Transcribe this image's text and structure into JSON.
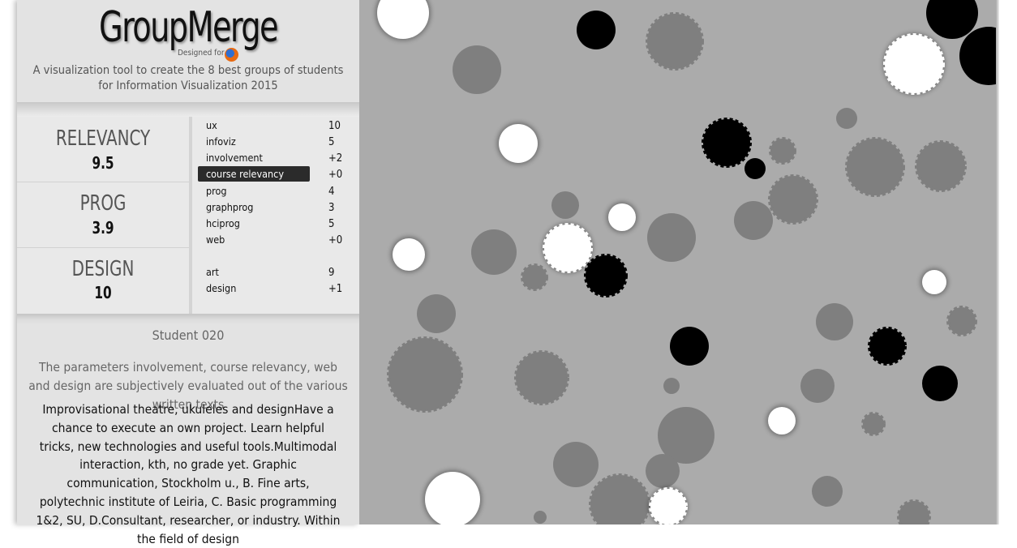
{
  "header": {
    "title": "GroupMerge",
    "designed_for": "Designed for",
    "browser_icon": "firefox-icon",
    "subtitle_line1": "A visualization tool to create the 8 best groups of students",
    "subtitle_line2": "for Information Visualization 2015"
  },
  "categories": [
    {
      "name": "RELEVANCY",
      "value": "9.5",
      "params": [
        {
          "name": "ux",
          "value": "10"
        },
        {
          "name": "infoviz",
          "value": "5"
        },
        {
          "name": "involvement",
          "value": "+2"
        },
        {
          "name": "course relevancy",
          "value": "+0",
          "selected": true
        }
      ]
    },
    {
      "name": "PROG",
      "value": "3.9",
      "params": [
        {
          "name": "prog",
          "value": "4"
        },
        {
          "name": "graphprog",
          "value": "3"
        },
        {
          "name": "hciprog",
          "value": "5"
        },
        {
          "name": "web",
          "value": "+0"
        }
      ]
    },
    {
      "name": "DESIGN",
      "value": "10",
      "params": [
        {
          "name": "art",
          "value": "9"
        },
        {
          "name": "design",
          "value": "+1"
        }
      ]
    }
  ],
  "student": {
    "name": "Student 020",
    "note": "The parameters involvement, course relevancy, web and design are subjectively evaluated out of the various written texts",
    "description": "Improvisational theatre, ukuleles and designHave a chance to execute an own project. Learn helpful tricks, new technologies and useful tools.Multimodal interaction, kth, no grade yet. Graphic communication, Stockholm u., B. Fine arts, polytechnic institute of Leiria, C. Basic programming 1&2, SU, D.Consultant, researcher, or industry. Within the field of design"
  },
  "colors": {
    "panel": "#e3e3e3",
    "viz_background": "#ababab",
    "bubble_gray": "#7f7f7f",
    "bubble_white": "#ffffff",
    "bubble_black": "#000000",
    "selected_param": "#2b2b2b"
  }
}
